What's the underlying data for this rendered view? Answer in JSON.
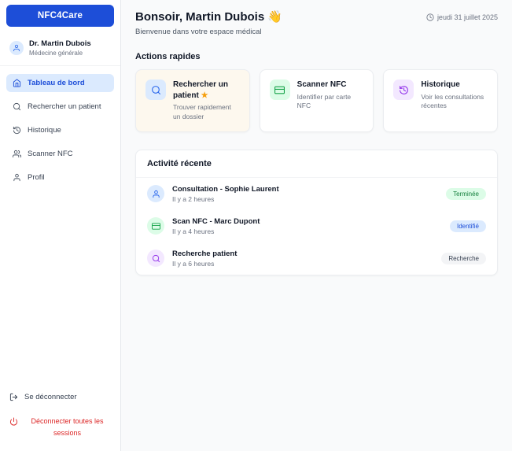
{
  "sidebar": {
    "brand": "NFC4Care",
    "user": {
      "name": "Dr. Martin Dubois",
      "role": "Médecine générale"
    },
    "nav": [
      {
        "label": "Tableau de bord",
        "icon": "home-icon",
        "active": true
      },
      {
        "label": "Rechercher un patient",
        "icon": "search-icon",
        "active": false
      },
      {
        "label": "Historique",
        "icon": "history-icon",
        "active": false
      },
      {
        "label": "Scanner NFC",
        "icon": "users-icon",
        "active": false
      },
      {
        "label": "Profil",
        "icon": "user-icon",
        "active": false
      }
    ],
    "logout_label": "Se déconnecter",
    "logout_all_label": "Déconnecter toutes les sessions"
  },
  "header": {
    "greeting": "Bonsoir, Martin Dubois",
    "greeting_emoji": "👋",
    "subtitle": "Bienvenue dans votre espace médical",
    "date": "jeudi 31 juillet 2025"
  },
  "quick_actions": {
    "title": "Actions rapides",
    "cards": [
      {
        "title": "Rechercher un patient",
        "star": "★",
        "subtitle": "Trouver rapidement un dossier",
        "icon": "search-icon",
        "color": "#2563eb"
      },
      {
        "title": "Scanner NFC",
        "subtitle": "Identifier par carte NFC",
        "icon": "nfc-card-icon",
        "color": "#16a34a"
      },
      {
        "title": "Historique",
        "subtitle": "Voir les consultations récentes",
        "icon": "history-icon",
        "color": "#9333ea"
      }
    ]
  },
  "recent_activity": {
    "title": "Activité récente",
    "items": [
      {
        "title": "Consultation - Sophie Laurent",
        "time": "Il y a 2 heures",
        "badge": "Terminée",
        "badge_color": "#15803d",
        "icon": "user-icon"
      },
      {
        "title": "Scan NFC - Marc Dupont",
        "time": "Il y a 4 heures",
        "badge": "Identifié",
        "badge_color": "#1d4ed8",
        "icon": "nfc-card-icon"
      },
      {
        "title": "Recherche patient",
        "time": "Il y a 6 heures",
        "badge": "Recherche",
        "badge_color": "#374151",
        "icon": "search-icon"
      }
    ]
  },
  "colors": {
    "primary": "#1d4ed8",
    "active_nav_bg": "#dbeafe",
    "success": "#16a34a",
    "purple": "#9333ea",
    "danger": "#dc2626",
    "main_bg": "#f9fafb"
  }
}
